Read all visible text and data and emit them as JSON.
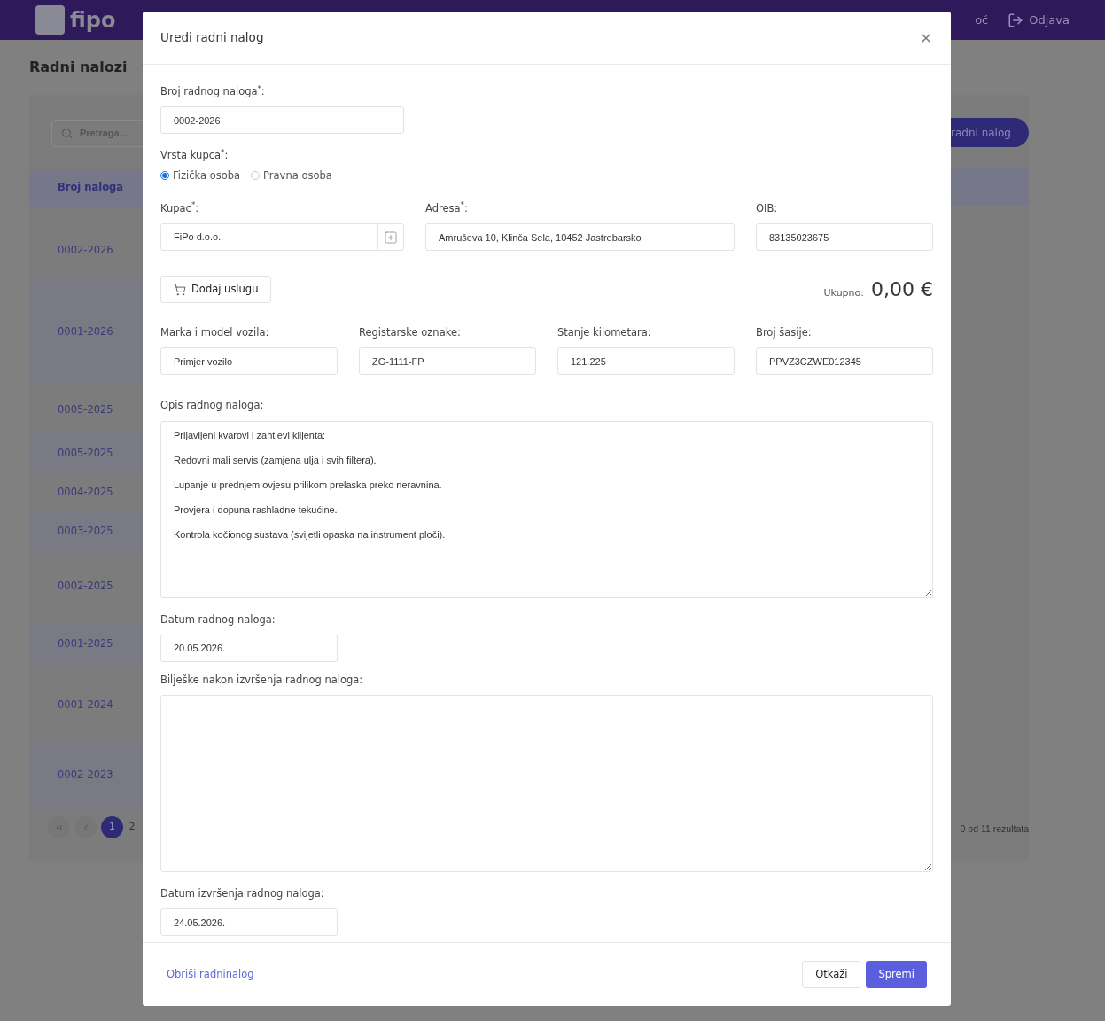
{
  "header": {
    "logo": "fipo",
    "nav_items": [
      {
        "label": "oć"
      },
      {
        "label": "Odjava"
      }
    ]
  },
  "page": {
    "title": "Radni nalozi",
    "search": {
      "placeholder": "Pretraga..."
    },
    "add_button": "radni nalog",
    "table": {
      "columns": [
        "Broj naloga"
      ],
      "rows": [
        {
          "number": "0002-2026"
        },
        {
          "number": "0001-2026"
        },
        {
          "number": "0005-2025"
        },
        {
          "number": "0005-2025"
        },
        {
          "number": "0004-2025"
        },
        {
          "number": "0003-2025"
        },
        {
          "number": "0002-2025"
        },
        {
          "number": "0001-2025"
        },
        {
          "number": "0001-2024"
        },
        {
          "number": "0002-2023"
        }
      ]
    },
    "pagination": {
      "pages": [
        {
          "label": "1",
          "selected": true
        },
        {
          "label": "2",
          "selected": false
        }
      ],
      "result_count": "0 od 11 rezultata"
    }
  },
  "modal": {
    "title": "Uredi radni nalog",
    "order_number": {
      "label": "Broj radnog naloga$^{*}$:",
      "value": "0002-2026"
    },
    "customer_type": {
      "label": "Vrsta kupca$^{*}$:",
      "options": [
        {
          "label": "Fizička osoba",
          "selected": true
        },
        {
          "label": "Pravna osoba",
          "selected": false
        }
      ]
    },
    "customer": {
      "label": "Kupac$^{*}$:",
      "value": "FiPo d.o.o."
    },
    "address": {
      "label": "Adresa$^{*}$:",
      "value": "Amruševa 10, Klinča Sela, 10452 Jastrebarsko"
    },
    "oib": {
      "label": "OIB:",
      "value": "83135023675"
    },
    "add_service_button": "Dodaj uslugu",
    "total_label": "Ukupno:",
    "total_value": "0,00 €",
    "vehicle_fields": [
      {
        "label": "Marka i model vozila:",
        "value": "Primjer vozilo"
      },
      {
        "label": "Registarske oznake:",
        "value": "ZG-1111-FP"
      },
      {
        "label": "Stanje kilometara:",
        "value": "121.225"
      },
      {
        "label": "Broj šasije:",
        "value": "PPVZ3CZWE012345"
      }
    ],
    "description": {
      "label": "Opis radnog naloga:",
      "value": "Prijavljeni kvarovi i zahtjevi klijenta:\n\nRedovni mali servis (zamjena ulja i svih filtera).\n\nLupanje u prednjem ovjesu prilikom prelaska preko neravnina.\n\nProvjera i dopuna rashladne tekućine.\n\nKontrola kočionog sustava (svijetli opaska na instrument ploči)."
    },
    "order_date": {
      "label": "Datum radnog naloga:",
      "value": "20.05.2026."
    },
    "notes": {
      "label": "Bilješke nakon izvršenja radnog naloga:"
    },
    "completion_date": {
      "label": "Datum izvršenja radnog naloga:",
      "value": "24.05.2026."
    },
    "delete_link": "Obriši radninalog",
    "cancel_button": "Otkaži",
    "save_button": "Spremi"
  }
}
